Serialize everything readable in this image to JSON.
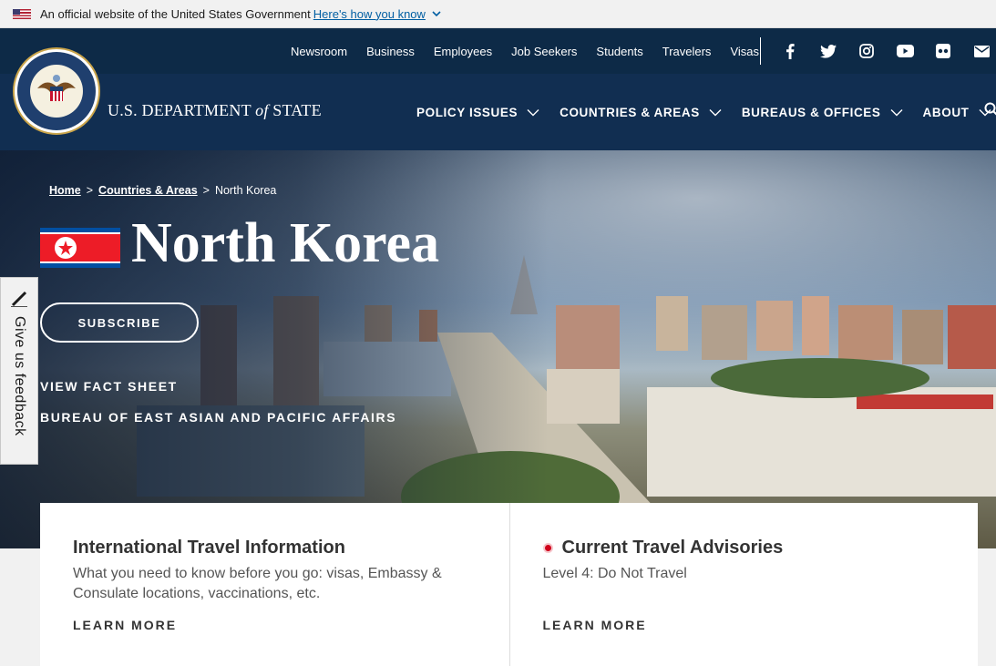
{
  "gov_banner": {
    "text": "An official website of the United States Government",
    "link": "Here's how you know"
  },
  "utility_nav": [
    "Newsroom",
    "Business",
    "Employees",
    "Job Seekers",
    "Students",
    "Travelers",
    "Visas"
  ],
  "social_icons": [
    "facebook-icon",
    "twitter-icon",
    "instagram-icon",
    "youtube-icon",
    "flickr-icon",
    "email-icon"
  ],
  "agency": {
    "name_pre": "U.S. DEPARTMENT ",
    "name_of": "of",
    "name_post": " STATE"
  },
  "main_nav": [
    "POLICY ISSUES",
    "COUNTRIES & AREAS",
    "BUREAUS & OFFICES",
    "ABOUT"
  ],
  "breadcrumb": {
    "home": "Home",
    "sep1": ">",
    "countries": "Countries & Areas",
    "sep2": ">",
    "current": "North Korea"
  },
  "hero": {
    "title": "North Korea",
    "subscribe": "SUBSCRIBE",
    "fact_sheet": "VIEW FACT SHEET",
    "bureau": "BUREAU OF EAST ASIAN AND PACIFIC AFFAIRS"
  },
  "feedback": "Give us feedback",
  "cards": [
    {
      "title": "International Travel Information",
      "desc": "What you need to know before you go: visas, Embassy & Consulate locations, vaccinations, etc.",
      "link": "LEARN MORE"
    },
    {
      "title": "Current Travel Advisories",
      "desc": "Level 4: Do Not Travel",
      "link": "LEARN MORE"
    }
  ],
  "colors": {
    "header_dark": "#0d2a47",
    "header": "#112e51",
    "advisory_dot": "#d0021b"
  }
}
